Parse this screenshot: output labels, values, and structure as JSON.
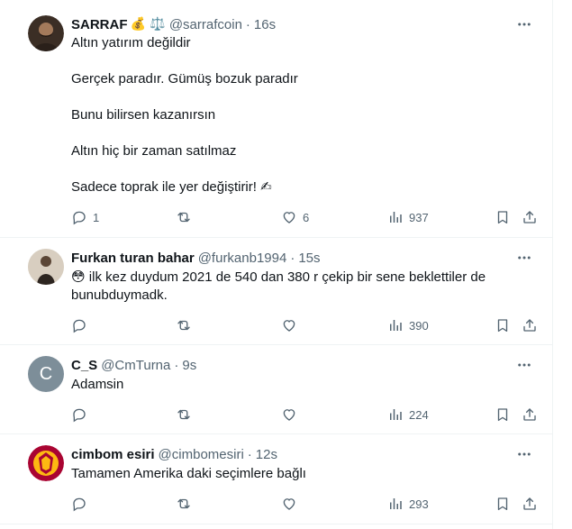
{
  "tweets": [
    {
      "name": "SARRAF",
      "badges": "💰 ⚖️",
      "handle": "@sarrafcoin",
      "separator": "·",
      "time": "16s",
      "lines": [
        "Altın yatırım değildir",
        "Gerçek paradır. Gümüş bozuk paradır",
        "Bunu bilirsen kazanırsın",
        "Altın hiç bir zaman satılmaz",
        "Sadece toprak ile yer değiştirir! ✍"
      ],
      "replies": "1",
      "retweets": "",
      "likes": "6",
      "views": "937"
    },
    {
      "name": "Furkan turan bahar",
      "handle": "@furkanb1994",
      "separator": "·",
      "time": "15s",
      "text": "😳 ilk kez duydum 2021 de 540 dan 380 r çekip bir sene beklettiler de bunubduymadk.",
      "replies": "",
      "retweets": "",
      "likes": "",
      "views": "390"
    },
    {
      "name": "C_S",
      "avatar_letter": "C",
      "handle": "@CmTurna",
      "separator": "·",
      "time": "9s",
      "text": "Adamsin",
      "replies": "",
      "retweets": "",
      "likes": "",
      "views": "224"
    },
    {
      "name": "cimbom esiri",
      "handle": "@cimbomesiri",
      "separator": "·",
      "time": "12s",
      "text": "Tamamen Amerika daki seçimlere bağlı",
      "replies": "",
      "retweets": "",
      "likes": "",
      "views": "293"
    }
  ],
  "icons": {
    "more": "more-horizontal-icon",
    "reply": "reply-bubble-icon",
    "retweet": "retweet-icon",
    "like": "heart-icon",
    "views": "views-bar-chart-icon",
    "bookmark": "bookmark-icon",
    "share": "share-upload-icon"
  },
  "colors": {
    "text": "#0f1419",
    "muted": "#536471",
    "divider": "#eff3f4",
    "placeholder_avatar": "#7d8e99"
  }
}
